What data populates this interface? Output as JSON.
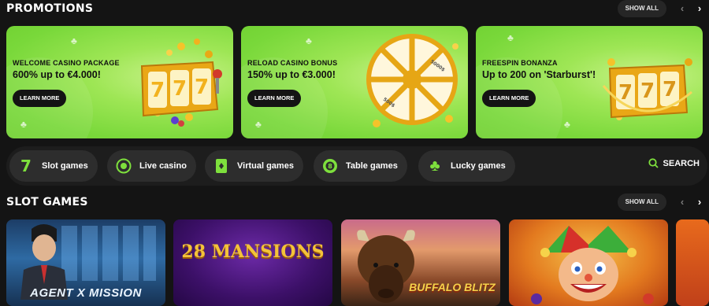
{
  "promotions": {
    "title": "PROMOTIONS",
    "show_all": "SHOW ALL",
    "prev": "‹",
    "next": "›",
    "cards": [
      {
        "title": "WELCOME CASINO PACKAGE",
        "offer": "600% up to €4.000!",
        "button": "LEARN MORE",
        "art": "slot-reels-777"
      },
      {
        "title": "RELOAD CASINO BONUS",
        "offer": "150% up to €3.000!",
        "button": "LEARN MORE",
        "art": "prize-wheel",
        "wheel_labels": [
          "5000$",
          "500$"
        ]
      },
      {
        "title": "FREESPIN BONANZA",
        "offer": "Up to 200 on 'Starburst'!",
        "button": "LEARN MORE",
        "art": "slot-reels-777"
      }
    ]
  },
  "categories": [
    {
      "label": "Slot games",
      "icon": "seven-icon"
    },
    {
      "label": "Live casino",
      "icon": "chip-icon"
    },
    {
      "label": "Virtual games",
      "icon": "card-icon"
    },
    {
      "label": "Table games",
      "icon": "ball-icon"
    },
    {
      "label": "Lucky games",
      "icon": "clover-icon"
    }
  ],
  "search": {
    "label": "SEARCH",
    "icon": "search-icon"
  },
  "slot_games": {
    "title": "SLOT GAMES",
    "show_all": "SHOW ALL",
    "prev": "‹",
    "next": "›",
    "games": [
      {
        "title": "AGENT X MISSION"
      },
      {
        "title": "28 MANSIONS"
      },
      {
        "title": "BUFFALO BLITZ"
      },
      {
        "title": ""
      }
    ]
  },
  "colors": {
    "accent": "#7ee03d",
    "background": "#141414",
    "promo_green": "#8fe04a"
  }
}
